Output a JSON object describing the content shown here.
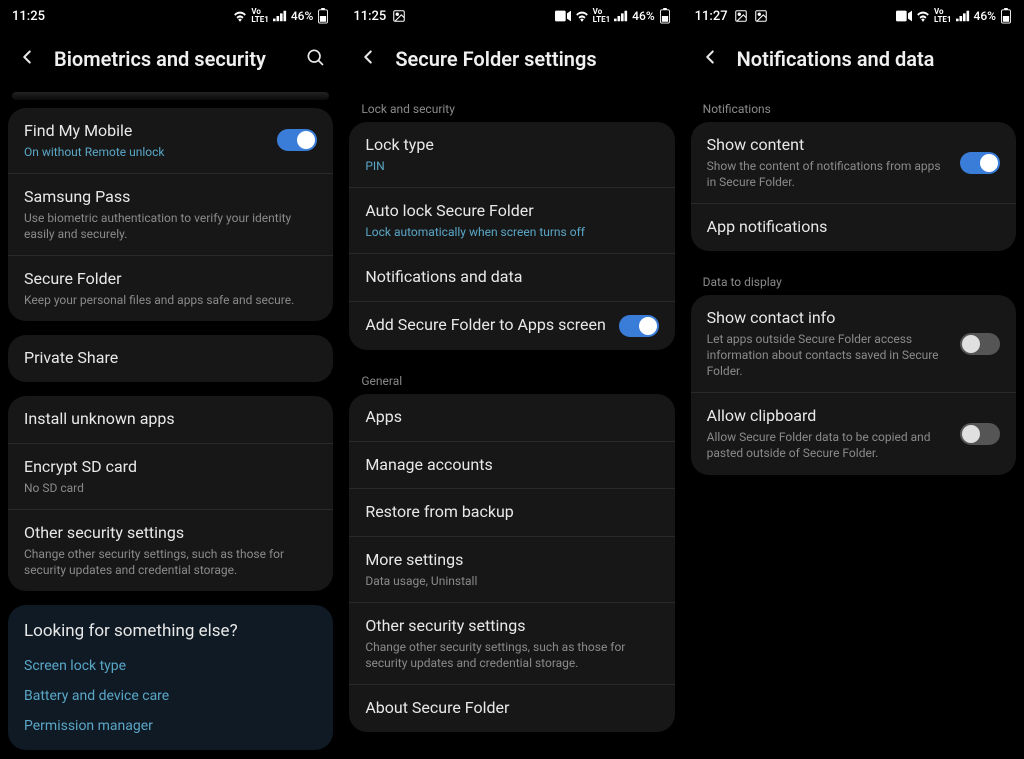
{
  "screens": [
    {
      "status": {
        "time": "11:25",
        "icons_left": [],
        "battery": "46%"
      },
      "title": "Biometrics and security",
      "has_search": true,
      "groups": [
        {
          "header": null,
          "items": [
            {
              "title": "Find My Mobile",
              "sub": "On without Remote unlock",
              "sub_accent": true,
              "toggle": "on"
            },
            {
              "title": "Samsung Pass",
              "sub": "Use biometric authentication to verify your identity easily and securely."
            },
            {
              "title": "Secure Folder",
              "sub": "Keep your personal files and apps safe and secure."
            }
          ]
        },
        {
          "header": null,
          "items": [
            {
              "title": "Private Share"
            }
          ]
        },
        {
          "header": null,
          "items": [
            {
              "title": "Install unknown apps"
            },
            {
              "title": "Encrypt SD card",
              "sub": "No SD card"
            },
            {
              "title": "Other security settings",
              "sub": "Change other security settings, such as those for security updates and credential storage."
            }
          ]
        }
      ],
      "looking": {
        "title": "Looking for something else?",
        "links": [
          "Screen lock type",
          "Battery and device care",
          "Permission manager"
        ]
      }
    },
    {
      "status": {
        "time": "11:25",
        "icons_left": [
          "photo"
        ],
        "battery": "46%",
        "extra_right": [
          "video"
        ]
      },
      "title": "Secure Folder settings",
      "has_search": false,
      "groups": [
        {
          "header": "Lock and security",
          "items": [
            {
              "title": "Lock type",
              "sub": "PIN",
              "sub_accent": true
            },
            {
              "title": "Auto lock Secure Folder",
              "sub": "Lock automatically when screen turns off",
              "sub_accent": true
            },
            {
              "title": "Notifications and data"
            },
            {
              "title": "Add Secure Folder to Apps screen",
              "toggle": "on"
            }
          ]
        },
        {
          "header": "General",
          "items": [
            {
              "title": "Apps"
            },
            {
              "title": "Manage accounts"
            },
            {
              "title": "Restore from backup"
            },
            {
              "title": "More settings",
              "sub": "Data usage, Uninstall"
            },
            {
              "title": "Other security settings",
              "sub": "Change other security settings, such as those for security updates and credential storage."
            },
            {
              "title": "About Secure Folder"
            }
          ]
        }
      ]
    },
    {
      "status": {
        "time": "11:27",
        "icons_left": [
          "photo",
          "photo"
        ],
        "battery": "46%",
        "extra_right": [
          "video"
        ]
      },
      "title": "Notifications and data",
      "has_search": false,
      "groups": [
        {
          "header": "Notifications",
          "items": [
            {
              "title": "Show content",
              "sub": "Show the content of notifications from apps in Secure Folder.",
              "toggle": "on"
            },
            {
              "title": "App notifications"
            }
          ]
        },
        {
          "header": "Data to display",
          "items": [
            {
              "title": "Show contact info",
              "sub": "Let apps outside Secure Folder access information about contacts saved in Secure Folder.",
              "toggle": "off"
            },
            {
              "title": "Allow clipboard",
              "sub": "Allow Secure Folder data to be copied and pasted outside of Secure Folder.",
              "toggle": "off"
            }
          ]
        }
      ]
    }
  ]
}
